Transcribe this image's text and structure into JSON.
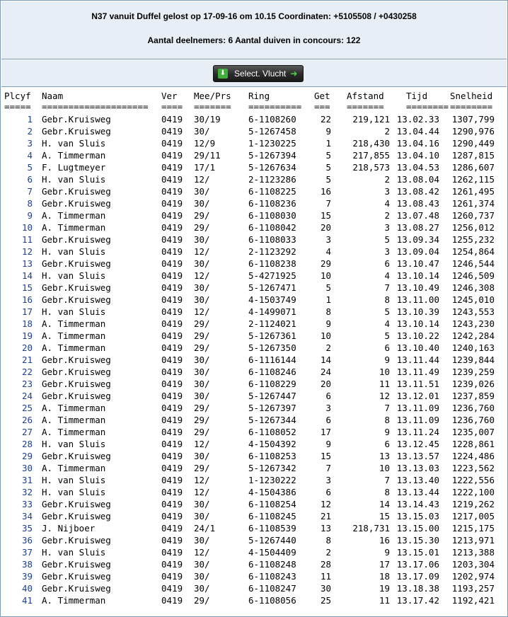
{
  "header": {
    "line1": "N37 vanuit Duffel gelost op 17-09-16 om 10.15 Coordinaten: +5105508 / +0430258",
    "line2": "Aantal deelnemers: 6 Aantal duiven in concours: 122"
  },
  "toolbar": {
    "select_label": "Select. Vlucht"
  },
  "table": {
    "headers": [
      "Plcyf",
      "Naam",
      "Ver",
      "Mee/Prs",
      "Ring",
      "Get",
      "Afstand",
      "Tijd",
      "Snelheid"
    ],
    "separators": [
      "=====",
      "====================",
      "====",
      "=======",
      "==========",
      "===",
      "=======",
      "========",
      "========"
    ],
    "rows": [
      [
        "1",
        "Gebr.Kruisweg",
        "0419",
        "30/19",
        "6-1108260",
        "22",
        "219,121",
        "13.02.33",
        "1307,799"
      ],
      [
        "2",
        "Gebr.Kruisweg",
        "0419",
        "30/",
        "5-1267458",
        "9",
        "2",
        "13.04.44",
        "1290,976"
      ],
      [
        "3",
        "H. van Sluis",
        "0419",
        "12/9",
        "1-1230225",
        "1",
        "218,430",
        "13.04.16",
        "1290,449"
      ],
      [
        "4",
        "A. Timmerman",
        "0419",
        "29/11",
        "5-1267394",
        "5",
        "217,855",
        "13.04.10",
        "1287,815"
      ],
      [
        "5",
        "F. Lugtmeyer",
        "0419",
        "17/1",
        "5-1267634",
        "5",
        "218,573",
        "13.04.53",
        "1286,607"
      ],
      [
        "6",
        "H. van Sluis",
        "0419",
        "12/",
        "2-1123286",
        "5",
        "2",
        "13.08.04",
        "1262,115"
      ],
      [
        "7",
        "Gebr.Kruisweg",
        "0419",
        "30/",
        "6-1108225",
        "16",
        "3",
        "13.08.42",
        "1261,495"
      ],
      [
        "8",
        "Gebr.Kruisweg",
        "0419",
        "30/",
        "6-1108236",
        "7",
        "4",
        "13.08.43",
        "1261,374"
      ],
      [
        "9",
        "A. Timmerman",
        "0419",
        "29/",
        "6-1108030",
        "15",
        "2",
        "13.07.48",
        "1260,737"
      ],
      [
        "10",
        "A. Timmerman",
        "0419",
        "29/",
        "6-1108042",
        "20",
        "3",
        "13.08.27",
        "1256,012"
      ],
      [
        "11",
        "Gebr.Kruisweg",
        "0419",
        "30/",
        "6-1108033",
        "3",
        "5",
        "13.09.34",
        "1255,232"
      ],
      [
        "12",
        "H. van Sluis",
        "0419",
        "12/",
        "2-1123292",
        "4",
        "3",
        "13.09.04",
        "1254,864"
      ],
      [
        "13",
        "Gebr.Kruisweg",
        "0419",
        "30/",
        "6-1108238",
        "29",
        "6",
        "13.10.47",
        "1246,544"
      ],
      [
        "14",
        "H. van Sluis",
        "0419",
        "12/",
        "5-4271925",
        "10",
        "4",
        "13.10.14",
        "1246,509"
      ],
      [
        "15",
        "Gebr.Kruisweg",
        "0419",
        "30/",
        "5-1267471",
        "5",
        "7",
        "13.10.49",
        "1246,308"
      ],
      [
        "16",
        "Gebr.Kruisweg",
        "0419",
        "30/",
        "4-1503749",
        "1",
        "8",
        "13.11.00",
        "1245,010"
      ],
      [
        "17",
        "H. van Sluis",
        "0419",
        "12/",
        "4-1499071",
        "8",
        "5",
        "13.10.39",
        "1243,553"
      ],
      [
        "18",
        "A. Timmerman",
        "0419",
        "29/",
        "2-1124021",
        "9",
        "4",
        "13.10.14",
        "1243,230"
      ],
      [
        "19",
        "A. Timmerman",
        "0419",
        "29/",
        "5-1267361",
        "10",
        "5",
        "13.10.22",
        "1242,284"
      ],
      [
        "20",
        "A. Timmerman",
        "0419",
        "29/",
        "5-1267350",
        "2",
        "6",
        "13.10.40",
        "1240,163"
      ],
      [
        "21",
        "Gebr.Kruisweg",
        "0419",
        "30/",
        "6-1116144",
        "14",
        "9",
        "13.11.44",
        "1239,844"
      ],
      [
        "22",
        "Gebr.Kruisweg",
        "0419",
        "30/",
        "6-1108246",
        "24",
        "10",
        "13.11.49",
        "1239,259"
      ],
      [
        "23",
        "Gebr.Kruisweg",
        "0419",
        "30/",
        "6-1108229",
        "20",
        "11",
        "13.11.51",
        "1239,026"
      ],
      [
        "24",
        "Gebr.Kruisweg",
        "0419",
        "30/",
        "5-1267447",
        "6",
        "12",
        "13.12.01",
        "1237,859"
      ],
      [
        "25",
        "A. Timmerman",
        "0419",
        "29/",
        "5-1267397",
        "3",
        "7",
        "13.11.09",
        "1236,760"
      ],
      [
        "26",
        "A. Timmerman",
        "0419",
        "29/",
        "5-1267344",
        "6",
        "8",
        "13.11.09",
        "1236,760"
      ],
      [
        "27",
        "A. Timmerman",
        "0419",
        "29/",
        "6-1108052",
        "17",
        "9",
        "13.11.24",
        "1235,007"
      ],
      [
        "28",
        "H. van Sluis",
        "0419",
        "12/",
        "4-1504392",
        "9",
        "6",
        "13.12.45",
        "1228,861"
      ],
      [
        "29",
        "Gebr.Kruisweg",
        "0419",
        "30/",
        "6-1108253",
        "15",
        "13",
        "13.13.57",
        "1224,486"
      ],
      [
        "30",
        "A. Timmerman",
        "0419",
        "29/",
        "5-1267342",
        "7",
        "10",
        "13.13.03",
        "1223,562"
      ],
      [
        "31",
        "H. van Sluis",
        "0419",
        "12/",
        "1-1230222",
        "3",
        "7",
        "13.13.40",
        "1222,556"
      ],
      [
        "32",
        "H. van Sluis",
        "0419",
        "12/",
        "4-1504386",
        "6",
        "8",
        "13.13.44",
        "1222,100"
      ],
      [
        "33",
        "Gebr.Kruisweg",
        "0419",
        "30/",
        "6-1108254",
        "12",
        "14",
        "13.14.43",
        "1219,262"
      ],
      [
        "34",
        "Gebr.Kruisweg",
        "0419",
        "30/",
        "6-1108245",
        "21",
        "15",
        "13.15.03",
        "1217,005"
      ],
      [
        "35",
        "J. Nijboer",
        "0419",
        "24/1",
        "6-1108539",
        "13",
        "218,731",
        "13.15.00",
        "1215,175"
      ],
      [
        "36",
        "Gebr.Kruisweg",
        "0419",
        "30/",
        "5-1267440",
        "8",
        "16",
        "13.15.30",
        "1213,971"
      ],
      [
        "37",
        "H. van Sluis",
        "0419",
        "12/",
        "4-1504409",
        "2",
        "9",
        "13.15.01",
        "1213,388"
      ],
      [
        "38",
        "Gebr.Kruisweg",
        "0419",
        "30/",
        "6-1108248",
        "28",
        "17",
        "13.17.06",
        "1203,304"
      ],
      [
        "39",
        "Gebr.Kruisweg",
        "0419",
        "30/",
        "6-1108243",
        "11",
        "18",
        "13.17.09",
        "1202,974"
      ],
      [
        "40",
        "Gebr.Kruisweg",
        "0419",
        "30/",
        "6-1108247",
        "30",
        "19",
        "13.18.38",
        "1193,257"
      ],
      [
        "41",
        "A. Timmerman",
        "0419",
        "29/",
        "6-1108056",
        "25",
        "11",
        "13.17.42",
        "1192,421"
      ]
    ]
  }
}
